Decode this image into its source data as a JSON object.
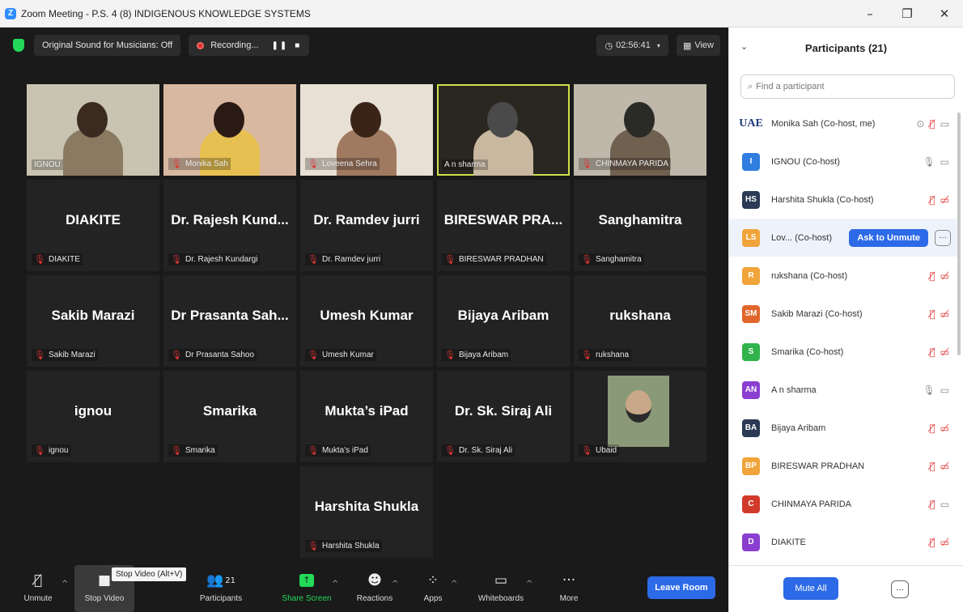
{
  "window": {
    "title": "Zoom Meeting - P.S. 4 (8) INDIGENOUS KNOWLEDGE SYSTEMS",
    "minimize": "–",
    "restore": "❐",
    "close": "✕"
  },
  "topbar": {
    "original_sound": "Original Sound for Musicians: Off",
    "recording": "Recording...",
    "pause": "❚❚",
    "stop": "■",
    "timer": "02:56:41",
    "view": "View"
  },
  "tiles": [
    {
      "big": "",
      "name": "IGNOU",
      "muted": false,
      "video": true
    },
    {
      "big": "",
      "name": "Monika Sah",
      "muted": true,
      "video": true
    },
    {
      "big": "",
      "name": "Loveena Sehra",
      "muted": true,
      "video": true
    },
    {
      "big": "",
      "name": "A n sharma",
      "muted": false,
      "video": true,
      "active": true
    },
    {
      "big": "",
      "name": "CHINMAYA PARIDA",
      "muted": true,
      "video": true
    },
    {
      "big": "DIAKITE",
      "name": "DIAKITE",
      "muted": true
    },
    {
      "big": "Dr. Rajesh Kund...",
      "name": "Dr. Rajesh Kundargi",
      "muted": true
    },
    {
      "big": "Dr. Ramdev jurri",
      "name": "Dr. Ramdev jurri",
      "muted": true
    },
    {
      "big": "BIRESWAR PRA...",
      "name": "BIRESWAR PRADHAN",
      "muted": true
    },
    {
      "big": "Sanghamitra",
      "name": "Sanghamitra",
      "muted": true
    },
    {
      "big": "Sakib Marazi",
      "name": "Sakib Marazi",
      "muted": true
    },
    {
      "big": "Dr Prasanta Sah...",
      "name": "Dr Prasanta Sahoo",
      "muted": true
    },
    {
      "big": "Umesh Kumar",
      "name": "Umesh Kumar",
      "muted": true
    },
    {
      "big": "Bijaya Aribam",
      "name": "Bijaya Aribam",
      "muted": true
    },
    {
      "big": "rukshana",
      "name": "rukshana",
      "muted": true
    },
    {
      "big": "ignou",
      "name": "ignou",
      "muted": true
    },
    {
      "big": "Smarika",
      "name": "Smarika",
      "muted": true
    },
    {
      "big": "Mukta’s iPad",
      "name": "Mukta's iPad",
      "muted": true
    },
    {
      "big": "Dr. Sk. Siraj Ali",
      "name": "Dr. Sk. Siraj Ali",
      "muted": true
    },
    {
      "big": "",
      "name": "Ubaid",
      "muted": true,
      "photo": true
    },
    {
      "big": "Harshita Shukla",
      "name": "Harshita Shukla",
      "muted": true
    }
  ],
  "toolbar": {
    "unmute": "Unmute",
    "stop_video": "Stop Video",
    "tooltip": "Stop Video (Alt+V)",
    "participants": "Participants",
    "participants_count": "21",
    "share_screen": "Share Screen",
    "reactions": "Reactions",
    "apps": "Apps",
    "whiteboards": "Whiteboards",
    "more": "More",
    "leave": "Leave Room"
  },
  "panel": {
    "title": "Participants (21)",
    "search_placeholder": "Find a participant",
    "ask_to_unmute": "Ask to Unmute",
    "mute_all": "Mute All",
    "participants": [
      {
        "initials": "UAE",
        "name": "Monika Sah (Co-host, me)",
        "color": "#ffffff",
        "logo": true,
        "mic": "muted",
        "cam": "on"
      },
      {
        "initials": "I",
        "name": "IGNOU (Co-host)",
        "color": "#2f7ee0",
        "mic": "on",
        "cam": "on"
      },
      {
        "initials": "HS",
        "name": "Harshita Shukla (Co-host)",
        "color": "#2b3a55",
        "mic": "muted",
        "cam": "off"
      },
      {
        "initials": "LS",
        "name": "Lov... (Co-host)",
        "color": "#f0a43a",
        "mic": "",
        "cam": "",
        "highlight": true
      },
      {
        "initials": "R",
        "name": "rukshana (Co-host)",
        "color": "#f0a43a",
        "mic": "muted",
        "cam": "off"
      },
      {
        "initials": "SM",
        "name": "Sakib Marazi (Co-host)",
        "color": "#e0662b",
        "mic": "muted",
        "cam": "off"
      },
      {
        "initials": "S",
        "name": "Smarika (Co-host)",
        "color": "#2fb34a",
        "mic": "muted",
        "cam": "off"
      },
      {
        "initials": "AN",
        "name": "A n sharma",
        "color": "#8a3fd1",
        "mic": "on",
        "cam": "on"
      },
      {
        "initials": "BA",
        "name": "Bijaya Aribam",
        "color": "#2b3a55",
        "mic": "muted",
        "cam": "off"
      },
      {
        "initials": "BP",
        "name": "BIRESWAR PRADHAN",
        "color": "#f0a43a",
        "mic": "muted",
        "cam": "off"
      },
      {
        "initials": "C",
        "name": "CHINMAYA PARIDA",
        "color": "#d13a2b",
        "mic": "muted",
        "cam": "on"
      },
      {
        "initials": "D",
        "name": "DIAKITE",
        "color": "#8a3fd1",
        "mic": "muted",
        "cam": "off"
      }
    ]
  },
  "colors": {
    "accent": "#2d6ae8",
    "muted_red": "#e23434",
    "active_speaker": "#cfe04b",
    "share_green": "#23d959"
  }
}
